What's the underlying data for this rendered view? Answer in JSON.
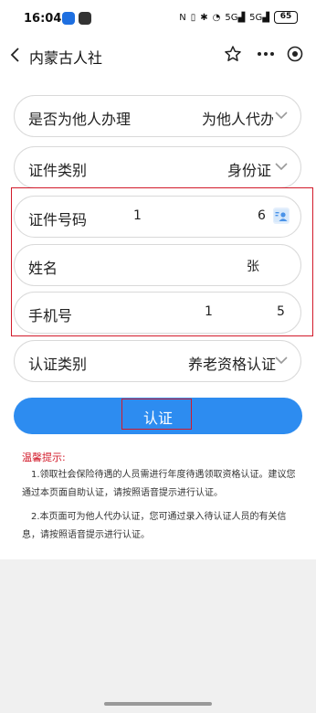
{
  "status_bar": {
    "time": "16:04",
    "network_a": "5G",
    "network_b": "5G",
    "battery": "65"
  },
  "nav": {
    "title": "内蒙古人社"
  },
  "form": {
    "proxy": {
      "label": "是否为他人办理",
      "value": "为他人代办"
    },
    "id_type": {
      "label": "证件类别",
      "value": "身份证"
    },
    "id_number": {
      "label": "证件号码",
      "value_start": "1",
      "value_end": "6"
    },
    "name": {
      "label": "姓名",
      "value": "张"
    },
    "phone": {
      "label": "手机号",
      "value_start": "1",
      "value_end": "5"
    },
    "auth_type": {
      "label": "认证类别",
      "value": "养老资格认证"
    }
  },
  "submit": {
    "label": "认证"
  },
  "tips": {
    "title": "温馨提示:",
    "items": [
      "1.领取社会保险待遇的人员需进行年度待遇领取资格认证。建议您通过本页面自助认证，请按照语音提示进行认证。",
      "2.本页面可为他人代办认证，您可通过录入待认证人员的有关信息，请按照语音提示进行认证。"
    ]
  },
  "colors": {
    "primary": "#2d8cf0",
    "highlight": "#d21a2a",
    "tip_title": "#d21a2a"
  }
}
